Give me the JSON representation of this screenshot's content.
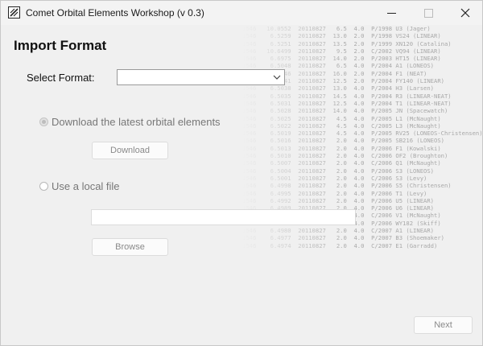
{
  "window": {
    "title": "Comet Orbital Elements Workshop (v 0.3)",
    "minimize_glyph": "—",
    "maximize_glyph": "☐",
    "close_glyph": "✕"
  },
  "page": {
    "heading": "Import Format",
    "select_label": "Select Format:",
    "select_value": ""
  },
  "options": {
    "download": {
      "label": "Download the latest orbital elements",
      "checked": true,
      "button_label": "Download"
    },
    "local": {
      "label": "Use a local file",
      "checked": false,
      "file_value": "",
      "button_label": "Browse"
    }
  },
  "footer": {
    "next_label": "Next"
  },
  "background_lines": [
    "1546   10.0552  20110827   6.5  4.0  P/1998 U3 (Jager)",
    "1546    6.5259  20110827  13.0  2.0  P/1998 VS24 (LINEAR)",
    "1546    6.5251  20110827  13.5  2.0  P/1999 XN120 (Catalina)",
    "1546   10.6499  20110827   9.5  2.0  C/2002 VQ94 (LINEAR)",
    "1546    6.6975  20110827  14.0  2.0  P/2003 HT15 (LINEAR)",
    "1546    6.5048  20110827   6.5  4.0  P/2004 A1 (LONEOS)",
    "1546    6.5046  20110827  16.0  2.0  P/2004 F1 (NEAT)",
    "1546    6.5041  20110827  12.5  2.0  P/2004 FY140 (LINEAR)",
    "1546    6.5038  20110827  13.0  4.0  P/2004 H3 (Larsen)",
    "1546    6.5035  20110827  14.5  4.0  P/2004 R3 (LINEAR-NEAT)",
    "1546    6.5031  20110827  12.5  4.0  P/2004 T1 (LINEAR-NEAT)",
    "1546    6.5028  20110827  14.0  4.0  P/2005 JN (Spacewatch)",
    "1546    6.5025  20110827   4.5  4.0  P/2005 L1 (McNaught)",
    "1546    6.5022  20110827   4.5  4.0  C/2005 L3 (McNaught)",
    "1546    6.5019  20110827   4.5  4.0  P/2005 RV25 (LONEOS-Christensen)",
    "1546    6.5016  20110827   2.0  4.0  P/2005 SB216 (LONEOS)",
    "1546    6.5013  20110827   2.0  4.0  P/2006 F1 (Kowalski)",
    "1546    6.5010  20110827   2.0  4.0  C/2006 OF2 (Broughton)",
    "1546    6.5007  20110827   2.0  4.0  C/2006 Q1 (McNaught)",
    "1546    6.5004  20110827   2.0  4.0  P/2006 S3 (LONEOS)",
    "1546    6.5001  20110827   2.0  4.0  C/2006 S3 (Levy)",
    "1546    6.4998  20110827   2.0  4.0  P/2006 S5 (Christensen)",
    "1546    6.4995  20110827   2.0  4.0  P/2006 T1 (Levy)",
    "1546    6.4992  20110827   2.0  4.0  P/2006 U5 (LINEAR)",
    "1546    6.4989  20110827   2.0  4.0  P/2006 U6 (LINEAR)",
    "1546    6.4986  20110827   2.0  4.0  C/2006 V1 (McNaught)",
    "1546    6.4983  20110827   2.0  4.0  P/2006 WY182 (Skiff)",
    "1546    6.4980  20110827   2.0  4.0  C/2007 A1 (LINEAR)",
    "1546    6.4977  20110827   2.0  4.0  P/2007 B3 (Shoemaker)",
    "1546    6.4974  20110827   2.0  4.0  C/2007 E1 (Garradd)"
  ]
}
